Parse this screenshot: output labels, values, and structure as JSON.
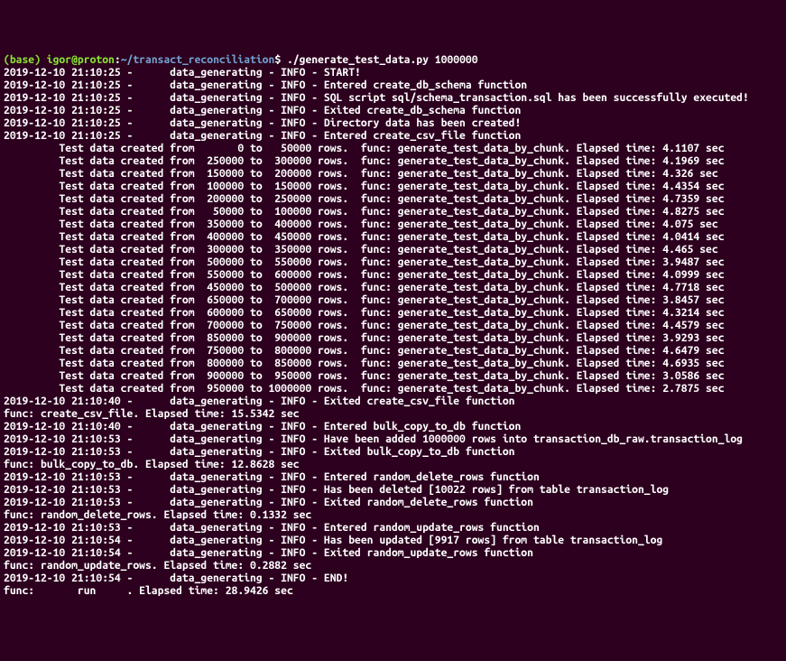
{
  "prompt": {
    "env": "(base)",
    "user": "igor",
    "at": "@",
    "host": "proton",
    "colon": ":",
    "path": "~/transact_reconciliation",
    "dollar": "$",
    "command": "./generate_test_data.py 1000000"
  },
  "logs": {
    "l00": "2019-12-10 21:10:25 -      data_generating - INFO - START!",
    "l01": "2019-12-10 21:10:25 -      data_generating - INFO - Entered create_db_schema function",
    "l02": "2019-12-10 21:10:25 -      data_generating - INFO - SQL script sql/schema_transaction.sql has been successfully executed!",
    "l03": "2019-12-10 21:10:25 -      data_generating - INFO - Exited create_db_schema function",
    "l04": "2019-12-10 21:10:25 -      data_generating - INFO - Directory data has been created!",
    "l05": "2019-12-10 21:10:25 -      data_generating - INFO - Entered create_csv_file function",
    "l06": "         Test data created from       0 to   50000 rows.  func: generate_test_data_by_chunk. Elapsed time: 4.1107 sec",
    "l07": "         Test data created from  250000 to  300000 rows.  func: generate_test_data_by_chunk. Elapsed time: 4.1969 sec",
    "l08": "         Test data created from  150000 to  200000 rows.  func: generate_test_data_by_chunk. Elapsed time: 4.326 sec",
    "l09": "         Test data created from  100000 to  150000 rows.  func: generate_test_data_by_chunk. Elapsed time: 4.4354 sec",
    "l10": "         Test data created from  200000 to  250000 rows.  func: generate_test_data_by_chunk. Elapsed time: 4.7359 sec",
    "l11": "         Test data created from   50000 to  100000 rows.  func: generate_test_data_by_chunk. Elapsed time: 4.8275 sec",
    "l12": "         Test data created from  350000 to  400000 rows.  func: generate_test_data_by_chunk. Elapsed time: 4.075 sec",
    "l13": "         Test data created from  400000 to  450000 rows.  func: generate_test_data_by_chunk. Elapsed time: 4.0414 sec",
    "l14": "         Test data created from  300000 to  350000 rows.  func: generate_test_data_by_chunk. Elapsed time: 4.465 sec",
    "l15": "         Test data created from  500000 to  550000 rows.  func: generate_test_data_by_chunk. Elapsed time: 3.9487 sec",
    "l16": "         Test data created from  550000 to  600000 rows.  func: generate_test_data_by_chunk. Elapsed time: 4.0999 sec",
    "l17": "         Test data created from  450000 to  500000 rows.  func: generate_test_data_by_chunk. Elapsed time: 4.7718 sec",
    "l18": "         Test data created from  650000 to  700000 rows.  func: generate_test_data_by_chunk. Elapsed time: 3.8457 sec",
    "l19": "         Test data created from  600000 to  650000 rows.  func: generate_test_data_by_chunk. Elapsed time: 4.3214 sec",
    "l20": "         Test data created from  700000 to  750000 rows.  func: generate_test_data_by_chunk. Elapsed time: 4.4579 sec",
    "l21": "         Test data created from  850000 to  900000 rows.  func: generate_test_data_by_chunk. Elapsed time: 3.9293 sec",
    "l22": "         Test data created from  750000 to  800000 rows.  func: generate_test_data_by_chunk. Elapsed time: 4.6479 sec",
    "l23": "         Test data created from  800000 to  850000 rows.  func: generate_test_data_by_chunk. Elapsed time: 4.6935 sec",
    "l24": "         Test data created from  900000 to  950000 rows.  func: generate_test_data_by_chunk. Elapsed time: 3.0586 sec",
    "l25": "         Test data created from  950000 to 1000000 rows.  func: generate_test_data_by_chunk. Elapsed time: 2.7875 sec",
    "l26": "2019-12-10 21:10:40 -      data_generating - INFO - Exited create_csv_file function",
    "l27": "func: create_csv_file. Elapsed time: 15.5342 sec",
    "l28": "2019-12-10 21:10:40 -      data_generating - INFO - Entered bulk_copy_to_db function",
    "l29": "2019-12-10 21:10:53 -      data_generating - INFO - Have been added 1000000 rows into transaction_db_raw.transaction_log",
    "l30": "2019-12-10 21:10:53 -      data_generating - INFO - Exited bulk_copy_to_db function",
    "l31": "func: bulk_copy_to_db. Elapsed time: 12.8628 sec",
    "l32": "2019-12-10 21:10:53 -      data_generating - INFO - Entered random_delete_rows function",
    "l33": "2019-12-10 21:10:53 -      data_generating - INFO - Has been deleted [10022 rows] from table transaction_log",
    "l34": "2019-12-10 21:10:53 -      data_generating - INFO - Exited random_delete_rows function",
    "l35": "func: random_delete_rows. Elapsed time: 0.1332 sec",
    "l36": "2019-12-10 21:10:53 -      data_generating - INFO - Entered random_update_rows function",
    "l37": "2019-12-10 21:10:54 -      data_generating - INFO - Has been updated [9917 rows] from table transaction_log",
    "l38": "2019-12-10 21:10:54 -      data_generating - INFO - Exited random_update_rows function",
    "l39": "func: random_update_rows. Elapsed time: 0.2882 sec",
    "l40": "2019-12-10 21:10:54 -      data_generating - INFO - END!",
    "l41": "func:       run     . Elapsed time: 28.9426 sec"
  }
}
